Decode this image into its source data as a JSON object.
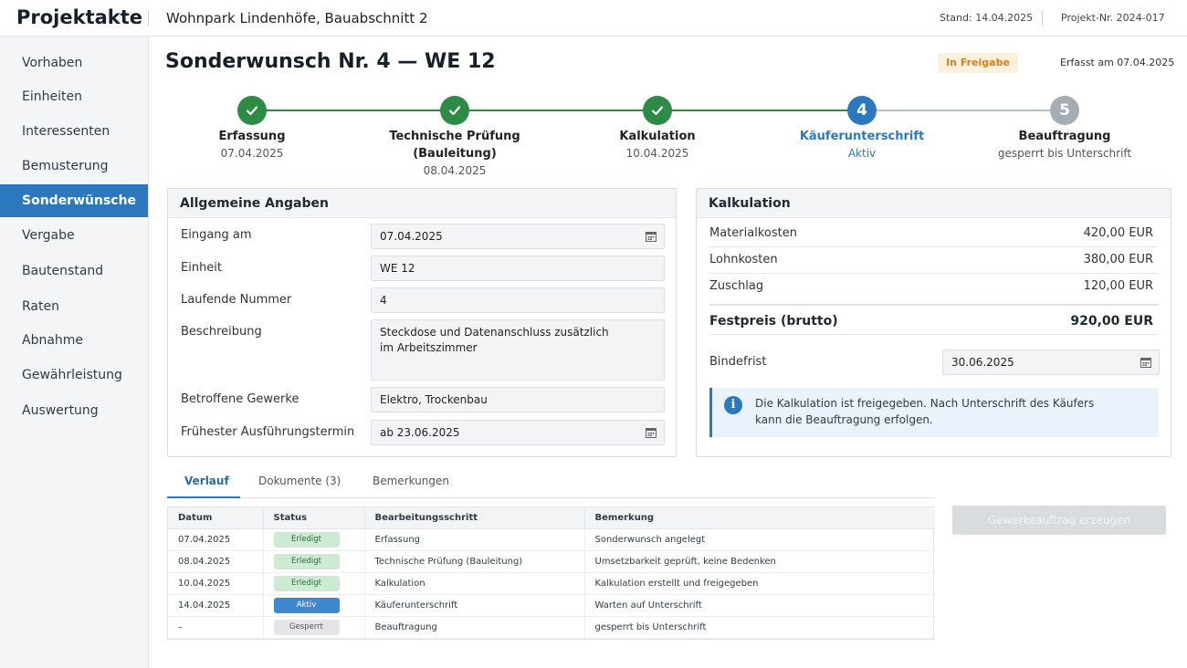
{
  "header": {
    "app_title": "Projektakte",
    "project_name": "Wohnpark Lindenhöfe, Bauabschnitt 2",
    "stand": "Stand: 14.04.2025",
    "project_nr": "Projekt-Nr. 2024-017"
  },
  "sidebar": {
    "items": [
      {
        "label": "Vorhaben"
      },
      {
        "label": "Einheiten"
      },
      {
        "label": "Interessenten"
      },
      {
        "label": "Bemusterung"
      },
      {
        "label": "Sonderwünsche"
      },
      {
        "label": "Vergabe"
      },
      {
        "label": "Bautenstand"
      },
      {
        "label": "Raten"
      },
      {
        "label": "Abnahme"
      },
      {
        "label": "Gewährleistung"
      },
      {
        "label": "Auswertung"
      }
    ],
    "active_index": 4
  },
  "page": {
    "title": "Sonderwunsch Nr. 4 — WE 12",
    "status_badge": "In Freigabe",
    "erfasst": "Erfasst am 07.04.2025"
  },
  "stepper": {
    "steps": [
      {
        "label": "Erfassung",
        "sub": "07.04.2025",
        "state": "done"
      },
      {
        "label": "Technische Prüfung (Bauleitung)",
        "sub": "08.04.2025",
        "state": "done"
      },
      {
        "label": "Kalkulation",
        "sub": "10.04.2025",
        "state": "done"
      },
      {
        "label": "Käuferunterschrift",
        "sub": "Aktiv",
        "state": "active",
        "number": "4"
      },
      {
        "label": "Beauftragung",
        "sub": "gesperrt bis Unterschrift",
        "state": "locked",
        "number": "5"
      }
    ]
  },
  "allgemein": {
    "title": "Allgemeine Angaben",
    "eingang_label": "Eingang am",
    "eingang_value": "07.04.2025",
    "einheit_label": "Einheit",
    "einheit_value": "WE 12",
    "nummer_label": "Laufende Nummer",
    "nummer_value": "4",
    "beschreibung_label": "Beschreibung",
    "beschreibung_line1": "Steckdose und Datenanschluss zusätzlich",
    "beschreibung_line2": "im Arbeitszimmer",
    "gewerke_label": "Betroffene Gewerke",
    "gewerke_value": "Elektro, Trockenbau",
    "termin_label": "Frühester Ausführungstermin",
    "termin_value": "ab 23.06.2025"
  },
  "kalkulation": {
    "title": "Kalkulation",
    "material_label": "Materialkosten",
    "material_value": "420,00 EUR",
    "lohn_label": "Lohnkosten",
    "lohn_value": "380,00 EUR",
    "zuschlag_label": "Zuschlag",
    "zuschlag_value": "120,00 EUR",
    "festpreis_label": "Festpreis (brutto)",
    "festpreis_value": "920,00 EUR",
    "bindefrist_label": "Bindefrist",
    "bindefrist_value": "30.06.2025",
    "info_line1": "Die Kalkulation ist freigegeben. Nach Unterschrift des Käufers",
    "info_line2": "kann die Beauftragung erfolgen."
  },
  "tabs": {
    "verlauf": "Verlauf",
    "dokumente": "Dokumente (3)",
    "bemerkungen": "Bemerkungen"
  },
  "verlauf": {
    "columns": [
      "Datum",
      "Status",
      "Bearbeitungsschritt",
      "Bemerkung"
    ],
    "rows": [
      {
        "datum": "07.04.2025",
        "status": "Erledigt",
        "kind": "erledigt",
        "schritt": "Erfassung",
        "bemerkung": "Sonderwunsch angelegt"
      },
      {
        "datum": "08.04.2025",
        "status": "Erledigt",
        "kind": "erledigt",
        "schritt": "Technische Prüfung (Bauleitung)",
        "bemerkung": "Umsetzbarkeit geprüft, keine Bedenken"
      },
      {
        "datum": "10.04.2025",
        "status": "Erledigt",
        "kind": "erledigt",
        "schritt": "Kalkulation",
        "bemerkung": "Kalkulation erstellt und freigegeben"
      },
      {
        "datum": "14.04.2025",
        "status": "Aktiv",
        "kind": "aktiv",
        "schritt": "Käuferunterschrift",
        "bemerkung": "Warten auf Unterschrift"
      },
      {
        "datum": "–",
        "status": "Gesperrt",
        "kind": "gesperrt",
        "schritt": "Beauftragung",
        "bemerkung": "gesperrt bis Unterschrift"
      }
    ]
  },
  "actions": {
    "gewerkeauftrag": "Gewerkeauftrag erzeugen"
  }
}
